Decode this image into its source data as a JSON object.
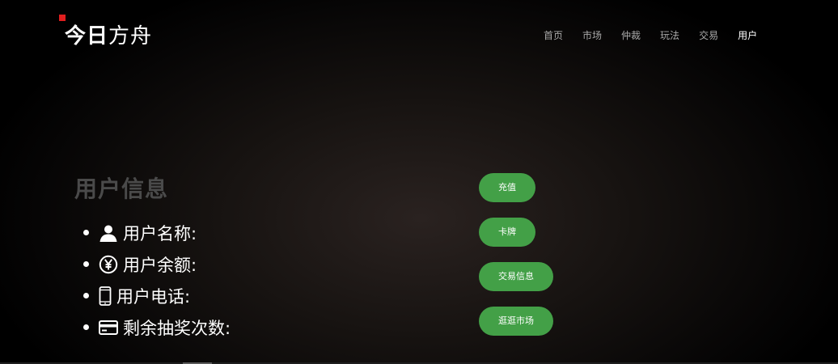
{
  "header": {
    "logo_bold": "今日",
    "logo_light": "方舟",
    "brand_color": "#e01e1e",
    "nav": [
      {
        "label": "首页",
        "active": false
      },
      {
        "label": "市场",
        "active": false
      },
      {
        "label": "仲裁",
        "active": false
      },
      {
        "label": "玩法",
        "active": false
      },
      {
        "label": "交易",
        "active": false
      },
      {
        "label": "用户",
        "active": true
      }
    ]
  },
  "main": {
    "title": "用户信息",
    "info": [
      {
        "icon": "user-icon",
        "label": "用户名称:"
      },
      {
        "icon": "yen-icon",
        "label": "用户余额:"
      },
      {
        "icon": "phone-icon",
        "label": "用户电话:"
      },
      {
        "icon": "card-icon",
        "label": "剩余抽奖次数:"
      }
    ],
    "buttons": [
      {
        "label": "充值"
      },
      {
        "label": "卡牌"
      },
      {
        "label": "交易信息"
      },
      {
        "label": "逛逛市场"
      }
    ],
    "button_color": "#43a047"
  }
}
